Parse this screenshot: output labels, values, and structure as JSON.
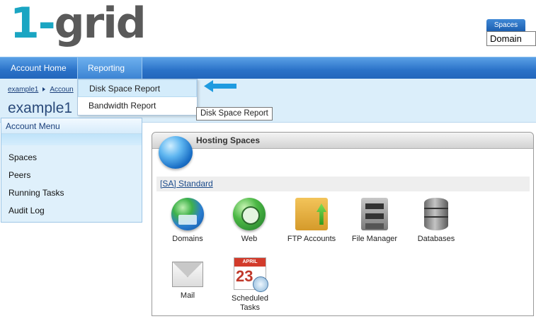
{
  "header": {
    "logo_one": "1-",
    "logo_grid": "grid",
    "spaces_label": "Spaces",
    "spaces_value": "Domain"
  },
  "nav": {
    "home_label": "Account Home",
    "reporting_label": "Reporting"
  },
  "dropdown": {
    "items": [
      {
        "label": "Disk Space Report"
      },
      {
        "label": "Bandwidth Report"
      }
    ],
    "tooltip": "Disk Space Report"
  },
  "breadcrumb": {
    "items": [
      "example1",
      "Accoun"
    ]
  },
  "page_title": "example1",
  "account_menu": {
    "title": "Account Menu",
    "items": [
      {
        "label": "Spaces"
      },
      {
        "label": "Peers"
      },
      {
        "label": "Running Tasks"
      },
      {
        "label": "Audit Log"
      }
    ]
  },
  "hosting": {
    "title": "Hosting Spaces",
    "space_link": "[SA] Standard",
    "tiles": [
      {
        "label": "Domains",
        "icon": "domains-globe-icon"
      },
      {
        "label": "Web",
        "icon": "web-globe-icon"
      },
      {
        "label": "FTP Accounts",
        "icon": "ftp-folder-icon"
      },
      {
        "label": "File Manager",
        "icon": "file-cabinet-icon"
      },
      {
        "label": "Databases",
        "icon": "database-icon"
      },
      {
        "label": "Mail",
        "icon": "mail-envelope-icon"
      },
      {
        "label": "Scheduled Tasks",
        "icon": "calendar-clock-icon"
      }
    ]
  },
  "calendar_icon": {
    "month": "APRIL",
    "day": "23"
  },
  "colors": {
    "nav_blue": "#2a72c8",
    "band": "#dbeefa",
    "arrow": "#1e9be0",
    "logo_cyan": "#1aa5c2",
    "logo_gray": "#5a5a5a"
  }
}
